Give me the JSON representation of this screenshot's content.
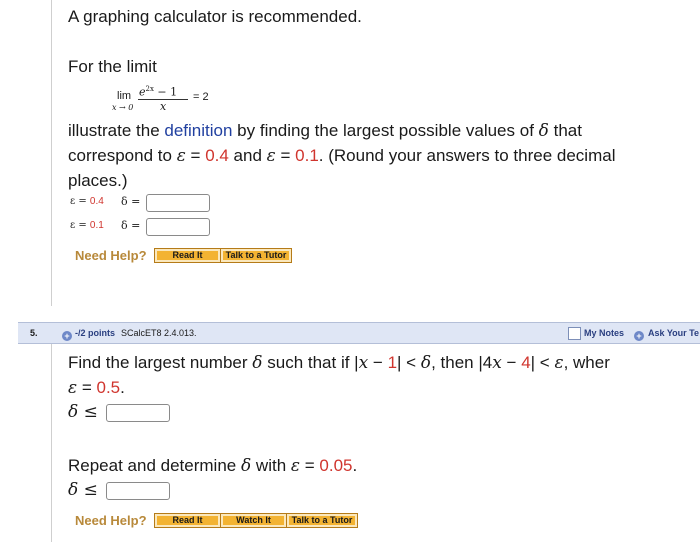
{
  "part4": {
    "intro": "A graphing calculator is recommended.",
    "for_limit": "For the limit",
    "limit": {
      "lim": "lim",
      "sub": "x → 0",
      "numerator": "e",
      "numerator_exp": "2x",
      "numerator_tail": " − 1",
      "denominator": "x",
      "equals": "= 2"
    },
    "text_1": "illustrate the ",
    "definition_link": "definition",
    "text_2": " by finding the largest possible values of ",
    "delta": "δ",
    "text_3": " that",
    "line2_1": "correspond to ",
    "eps": "ε",
    "line2_2": " = ",
    "eps_val_1": "0.4",
    "line2_3": " and ",
    "line2_4": " = ",
    "eps_val_2": "0.1",
    "line2_5": ". (Round your answers to three decimal",
    "line3": "places.)",
    "rows": [
      {
        "eps_label": "ε = ",
        "eps_value": "0.4",
        "delta_label": "δ =",
        "answer": ""
      },
      {
        "eps_label": "ε = ",
        "eps_value": "0.1",
        "delta_label": "δ =",
        "answer": ""
      }
    ],
    "need_help": "Need Help?",
    "buttons": [
      "Read It",
      "Talk to a Tutor"
    ]
  },
  "question5": {
    "number": "5.",
    "plus": "+",
    "points": "-/2 points",
    "code": "SCalcET8 2.4.013.",
    "my_notes": "My Notes",
    "ask_teacher": "Ask Your Te",
    "line1_a": "Find the largest number ",
    "delta": "δ",
    "line1_b": " such that if |",
    "x": "x",
    "line1_c": " − ",
    "one": "1",
    "line1_d": "| < ",
    "line1_e": ", then |4",
    "line1_f": " − ",
    "four": "4",
    "line1_g": "| < ",
    "eps": "ε",
    "line1_h": ", wher",
    "line2_eq": " = ",
    "line2_val": "0.5",
    "line2_end": ".",
    "leq": " ≤",
    "repeat_a": "Repeat and determine ",
    "repeat_b": " with ",
    "repeat_c": " = ",
    "repeat_val": "0.05",
    "repeat_end": ".",
    "answer_1": "",
    "answer_2": "",
    "need_help": "Need Help?",
    "buttons": [
      "Read It",
      "Watch It",
      "Talk to a Tutor"
    ]
  }
}
